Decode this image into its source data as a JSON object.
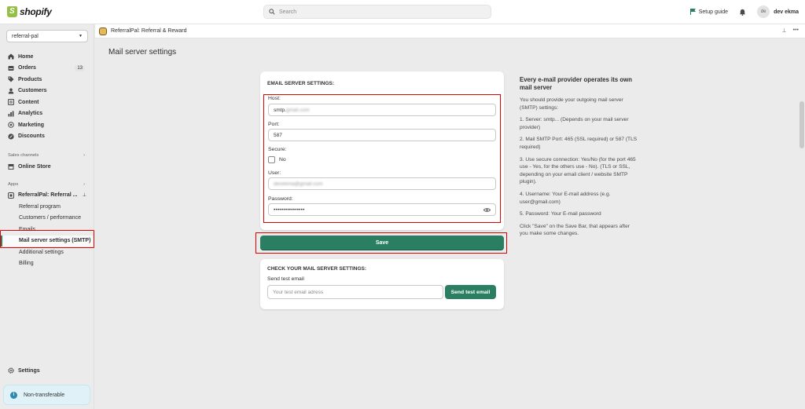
{
  "topbar": {
    "logo_text": "shopify",
    "search_placeholder": "Search",
    "setup_guide": "Setup guide",
    "avatar_initials": "de",
    "user_name": "dev ekma"
  },
  "sidebar": {
    "store": "referral-pal",
    "nav": [
      {
        "label": "Home",
        "icon": "home-icon"
      },
      {
        "label": "Orders",
        "icon": "orders-icon",
        "badge": "13"
      },
      {
        "label": "Products",
        "icon": "tag-icon"
      },
      {
        "label": "Customers",
        "icon": "person-icon"
      },
      {
        "label": "Content",
        "icon": "content-icon"
      },
      {
        "label": "Analytics",
        "icon": "chart-icon"
      },
      {
        "label": "Marketing",
        "icon": "target-icon"
      },
      {
        "label": "Discounts",
        "icon": "discount-icon"
      }
    ],
    "sales_channels_label": "Sales channels",
    "online_store": "Online Store",
    "apps_label": "Apps",
    "app_name": "ReferralPal: Referral ...",
    "app_sub_items": [
      "Referral program",
      "Customers / performance",
      "Emails",
      "Mail server settings (SMTP)",
      "Additional settings",
      "Billing"
    ],
    "settings": "Settings",
    "non_transferable": "Non-transferable"
  },
  "appbar": {
    "title": "ReferralPal: Referral & Reward"
  },
  "page": {
    "title": "Mail server settings"
  },
  "form": {
    "section_title": "EMAIL SERVER SETTINGS:",
    "host_label": "Host:",
    "host_value": "smtp.gmail.com",
    "port_label": "Port:",
    "port_value": "587",
    "secure_label": "Secure:",
    "secure_value": "No",
    "user_label": "User:",
    "user_value": "devekma@gmail.com",
    "password_label": "Password:",
    "password_value": "••••••••••••••••",
    "save_label": "Save"
  },
  "test": {
    "section_title": "CHECK YOUR MAIL SERVER SETTINGS:",
    "label": "Send test email",
    "placeholder": "Your test email adress",
    "button": "Send test email"
  },
  "help": {
    "title": "Every e-mail provider operates its own mail server",
    "paragraphs": [
      "You should provide your outgoing mail server (SMTP) settings:",
      "1. Server: smtp... (Depends on your mail server provider)",
      "2. Mail SMTP Port: 465 (SSL required) or 587 (TLS required)",
      "3. Use secure connection: Yes/No (for the port 465 use - Yes, for the others use - No). (TLS or SSL, depending on your email client / website SMTP plugin).",
      "4. Username: Your E-mail address (e.g. user@gmail.com)",
      "5. Password: Your E-mail password",
      "Click \"Save\" on the Save Bar, that appears after you make some changes."
    ]
  },
  "colors": {
    "primary_green": "#2a7f62",
    "highlight_red": "#e00000",
    "shopify_green": "#95bf47"
  }
}
